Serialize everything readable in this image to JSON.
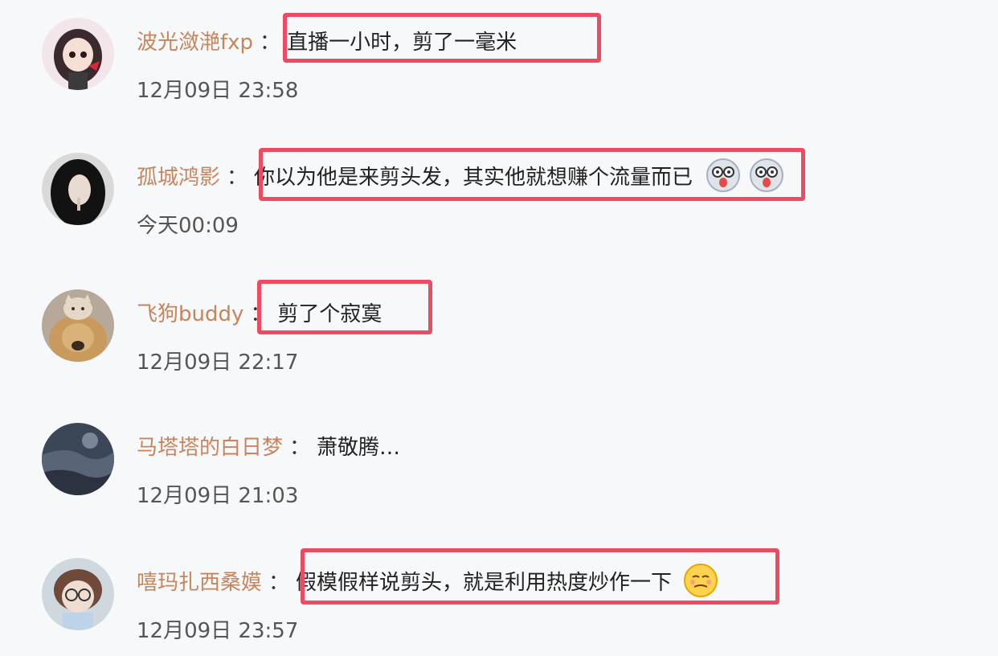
{
  "comments": [
    {
      "user": "波光潋滟fxp",
      "sep": "：",
      "text": "直播一小时，剪了一毫米",
      "time": "12月09日 23:58",
      "avatar_icon": "girl-cartoon-avatar"
    },
    {
      "user": "孤城鸿影",
      "sep": "：",
      "text": "你以为他是来剪头发，其实他就想赚个流量而已",
      "time": "今天00:09",
      "avatar_icon": "woman-photo-avatar",
      "emojis": [
        "shocked-face-icon",
        "shocked-face-icon"
      ]
    },
    {
      "user": "飞狗buddy",
      "sep": "：",
      "text": "剪了个寂寞",
      "time": "12月09日 22:17",
      "avatar_icon": "cat-and-dog-avatar"
    },
    {
      "user": "马塔塔的白日梦",
      "sep": "：",
      "text": "萧敬腾…",
      "time": "12月09日 21:03",
      "avatar_icon": "landscape-avatar"
    },
    {
      "user": "嘻玛扎西桑嫫",
      "sep": "：",
      "text": "假模假样说剪头，就是利用热度炒作一下",
      "time": "12月09日 23:57",
      "avatar_icon": "girl-glasses-avatar",
      "emojis": [
        "sneer-face-icon"
      ]
    }
  ],
  "colors": {
    "username": "#c8845b",
    "highlight": "#ee4a62",
    "background": "#f7f8fa"
  }
}
